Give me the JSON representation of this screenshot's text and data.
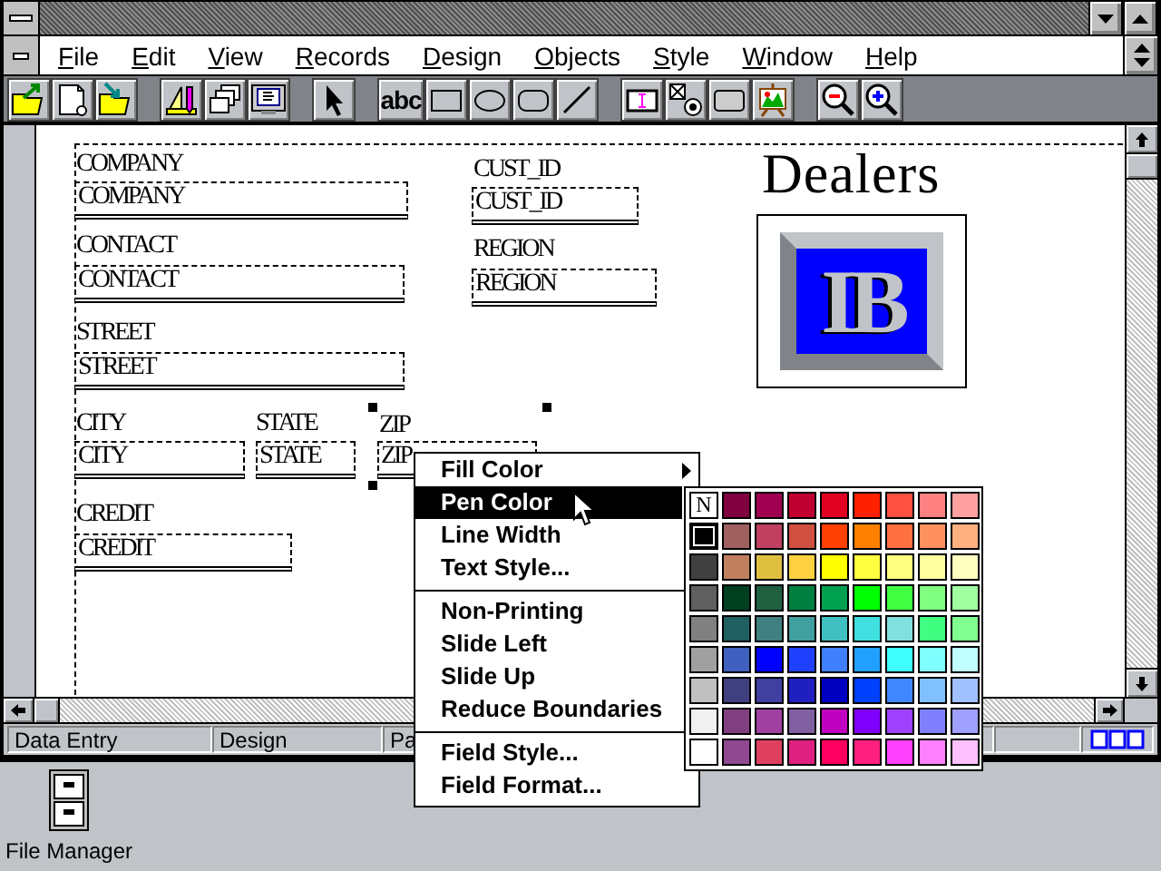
{
  "menu_bar": {
    "items": [
      "File",
      "Edit",
      "View",
      "Records",
      "Design",
      "Objects",
      "Style",
      "Window",
      "Help"
    ]
  },
  "toolbar": {
    "groups": [
      [
        {
          "kind": "open-folder"
        },
        {
          "kind": "new-document"
        },
        {
          "kind": "import-folder"
        }
      ],
      [
        {
          "kind": "ruler-pencil"
        },
        {
          "kind": "stacked-cards"
        },
        {
          "kind": "monitor"
        }
      ],
      [
        {
          "kind": "pointer"
        }
      ],
      [
        {
          "kind": "text",
          "label": "abc"
        },
        {
          "kind": "rectangle"
        },
        {
          "kind": "ellipse"
        },
        {
          "kind": "rounded-rectangle"
        },
        {
          "kind": "line"
        }
      ],
      [
        {
          "kind": "field-frame"
        },
        {
          "kind": "checkbox-radio"
        },
        {
          "kind": "button-shape"
        },
        {
          "kind": "easel"
        }
      ],
      [
        {
          "kind": "zoom-out"
        },
        {
          "kind": "zoom-in"
        }
      ]
    ]
  },
  "form": {
    "title": "Dealers",
    "logo": {
      "text": "IB"
    },
    "fields": [
      {
        "label": "COMPANY",
        "value": "COMPANY",
        "selected": false
      },
      {
        "label": "CUST_ID",
        "value": "CUST_ID",
        "selected": false
      },
      {
        "label": "CONTACT",
        "value": "CONTACT",
        "selected": false
      },
      {
        "label": "REGION",
        "value": "REGION",
        "selected": false
      },
      {
        "label": "STREET",
        "value": "STREET",
        "selected": false
      },
      {
        "label": "CITY",
        "value": "CITY",
        "selected": false
      },
      {
        "label": "STATE",
        "value": "STATE",
        "selected": false
      },
      {
        "label": "ZIP",
        "value": "ZIP",
        "selected": true
      },
      {
        "label": "CREDIT",
        "value": "CREDIT",
        "selected": false
      }
    ]
  },
  "status_bar": {
    "panes": [
      "Data Entry",
      "Design",
      "Pa"
    ]
  },
  "context_menu": {
    "groups": [
      [
        {
          "label": "Fill Color",
          "selected": false,
          "submenu": true
        },
        {
          "label": "Pen Color",
          "selected": true,
          "submenu": false
        },
        {
          "label": "Line Width",
          "selected": false,
          "submenu": false
        },
        {
          "label": "Text Style...",
          "selected": false,
          "submenu": false
        }
      ],
      [
        {
          "label": "Non-Printing",
          "selected": false,
          "submenu": false
        },
        {
          "label": "Slide Left",
          "selected": false,
          "submenu": false
        },
        {
          "label": "Slide Up",
          "selected": false,
          "submenu": false
        },
        {
          "label": "Reduce Boundaries",
          "selected": false,
          "submenu": false
        }
      ],
      [
        {
          "label": "Field Style...",
          "selected": false,
          "submenu": false
        },
        {
          "label": "Field Format...",
          "selected": false,
          "submenu": false
        }
      ]
    ]
  },
  "color_palette": {
    "swatches": [
      {
        "kind": "none",
        "label": "N",
        "selected": false
      },
      {
        "kind": "color",
        "color": "#800040",
        "selected": false
      },
      {
        "kind": "color",
        "color": "#a00050",
        "selected": false
      },
      {
        "kind": "color",
        "color": "#c00030",
        "selected": false
      },
      {
        "kind": "color",
        "color": "#e00020",
        "selected": false
      },
      {
        "kind": "color",
        "color": "#ff2000",
        "selected": false
      },
      {
        "kind": "color",
        "color": "#ff5040",
        "selected": false
      },
      {
        "kind": "color",
        "color": "#ff8080",
        "selected": false
      },
      {
        "kind": "color",
        "color": "#ffa0a0",
        "selected": false
      },
      {
        "kind": "color",
        "color": "#000000",
        "selected": true
      },
      {
        "kind": "color",
        "color": "#a06060",
        "selected": false
      },
      {
        "kind": "color",
        "color": "#c04060",
        "selected": false
      },
      {
        "kind": "color",
        "color": "#d05040",
        "selected": false
      },
      {
        "kind": "color",
        "color": "#ff4000",
        "selected": false
      },
      {
        "kind": "color",
        "color": "#ff8000",
        "selected": false
      },
      {
        "kind": "color",
        "color": "#ff7040",
        "selected": false
      },
      {
        "kind": "color",
        "color": "#ff9060",
        "selected": false
      },
      {
        "kind": "color",
        "color": "#ffb080",
        "selected": false
      },
      {
        "kind": "color",
        "color": "#404040",
        "selected": false
      },
      {
        "kind": "color",
        "color": "#c08060",
        "selected": false
      },
      {
        "kind": "color",
        "color": "#e0c040",
        "selected": false
      },
      {
        "kind": "color",
        "color": "#ffd040",
        "selected": false
      },
      {
        "kind": "color",
        "color": "#ffff00",
        "selected": false
      },
      {
        "kind": "color",
        "color": "#ffff40",
        "selected": false
      },
      {
        "kind": "color",
        "color": "#ffff80",
        "selected": false
      },
      {
        "kind": "color",
        "color": "#ffffa0",
        "selected": false
      },
      {
        "kind": "color",
        "color": "#ffffc0",
        "selected": false
      },
      {
        "kind": "color",
        "color": "#606060",
        "selected": false
      },
      {
        "kind": "color",
        "color": "#004020",
        "selected": false
      },
      {
        "kind": "color",
        "color": "#206040",
        "selected": false
      },
      {
        "kind": "color",
        "color": "#008040",
        "selected": false
      },
      {
        "kind": "color",
        "color": "#00a050",
        "selected": false
      },
      {
        "kind": "color",
        "color": "#00ff00",
        "selected": false
      },
      {
        "kind": "color",
        "color": "#40ff40",
        "selected": false
      },
      {
        "kind": "color",
        "color": "#80ff80",
        "selected": false
      },
      {
        "kind": "color",
        "color": "#a0ffa0",
        "selected": false
      },
      {
        "kind": "color",
        "color": "#808080",
        "selected": false
      },
      {
        "kind": "color",
        "color": "#206060",
        "selected": false
      },
      {
        "kind": "color",
        "color": "#408080",
        "selected": false
      },
      {
        "kind": "color",
        "color": "#40a0a0",
        "selected": false
      },
      {
        "kind": "color",
        "color": "#40c0c0",
        "selected": false
      },
      {
        "kind": "color",
        "color": "#40e0e0",
        "selected": false
      },
      {
        "kind": "color",
        "color": "#80e0e0",
        "selected": false
      },
      {
        "kind": "color",
        "color": "#40ff80",
        "selected": false
      },
      {
        "kind": "color",
        "color": "#80ff90",
        "selected": false
      },
      {
        "kind": "color",
        "color": "#a0a0a0",
        "selected": false
      },
      {
        "kind": "color",
        "color": "#4060c0",
        "selected": false
      },
      {
        "kind": "color",
        "color": "#0000ff",
        "selected": false
      },
      {
        "kind": "color",
        "color": "#2040ff",
        "selected": false
      },
      {
        "kind": "color",
        "color": "#4080ff",
        "selected": false
      },
      {
        "kind": "color",
        "color": "#20a0ff",
        "selected": false
      },
      {
        "kind": "color",
        "color": "#40ffff",
        "selected": false
      },
      {
        "kind": "color",
        "color": "#80ffff",
        "selected": false
      },
      {
        "kind": "color",
        "color": "#c0ffff",
        "selected": false
      },
      {
        "kind": "color",
        "color": "#c0c0c0",
        "selected": false
      },
      {
        "kind": "color",
        "color": "#404080",
        "selected": false
      },
      {
        "kind": "color",
        "color": "#4040a0",
        "selected": false
      },
      {
        "kind": "color",
        "color": "#2020c0",
        "selected": false
      },
      {
        "kind": "color",
        "color": "#0000c0",
        "selected": false
      },
      {
        "kind": "color",
        "color": "#0040ff",
        "selected": false
      },
      {
        "kind": "color",
        "color": "#4088ff",
        "selected": false
      },
      {
        "kind": "color",
        "color": "#80c0ff",
        "selected": false
      },
      {
        "kind": "color",
        "color": "#a0c0ff",
        "selected": false
      },
      {
        "kind": "color",
        "color": "#f0f0f0",
        "selected": false
      },
      {
        "kind": "color",
        "color": "#804080",
        "selected": false
      },
      {
        "kind": "color",
        "color": "#a040a0",
        "selected": false
      },
      {
        "kind": "color",
        "color": "#8060a0",
        "selected": false
      },
      {
        "kind": "color",
        "color": "#c000c0",
        "selected": false
      },
      {
        "kind": "color",
        "color": "#8000ff",
        "selected": false
      },
      {
        "kind": "color",
        "color": "#a040ff",
        "selected": false
      },
      {
        "kind": "color",
        "color": "#8080ff",
        "selected": false
      },
      {
        "kind": "color",
        "color": "#a0a0ff",
        "selected": false
      },
      {
        "kind": "color",
        "color": "#ffffff",
        "selected": false
      },
      {
        "kind": "color",
        "color": "#904890",
        "selected": false
      },
      {
        "kind": "color",
        "color": "#e04060",
        "selected": false
      },
      {
        "kind": "color",
        "color": "#e02080",
        "selected": false
      },
      {
        "kind": "color",
        "color": "#ff0060",
        "selected": false
      },
      {
        "kind": "color",
        "color": "#ff2080",
        "selected": false
      },
      {
        "kind": "color",
        "color": "#ff40ff",
        "selected": false
      },
      {
        "kind": "color",
        "color": "#ff80ff",
        "selected": false
      },
      {
        "kind": "color",
        "color": "#ffc0ff",
        "selected": false
      }
    ]
  },
  "desktop": {
    "icons": [
      {
        "label": "File Manager"
      }
    ]
  }
}
